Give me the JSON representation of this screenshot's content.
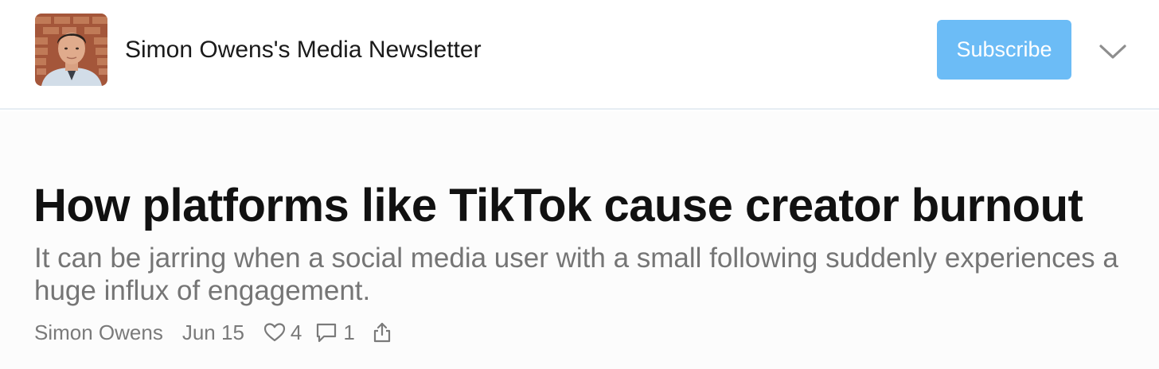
{
  "header": {
    "publication_name": "Simon Owens's Media Newsletter",
    "subscribe_label": "Subscribe",
    "menu_icon": "chevron-down-icon",
    "avatar_icon": "author-avatar-photo"
  },
  "post": {
    "title": "How platforms like TikTok cause creator burnout",
    "subtitle": "It can be jarring when a social media user with a small following suddenly experiences a huge influx of engagement.",
    "author": "Simon Owens",
    "date": "Jun 15",
    "likes": "4",
    "comments": "1",
    "like_icon": "heart-icon",
    "comment_icon": "comment-icon",
    "share_icon": "share-icon"
  },
  "colors": {
    "accent": "#6cbcf6",
    "title": "#111111",
    "subtitle": "#757575",
    "meta": "#7a7a7a",
    "divider": "#e6edf3"
  }
}
